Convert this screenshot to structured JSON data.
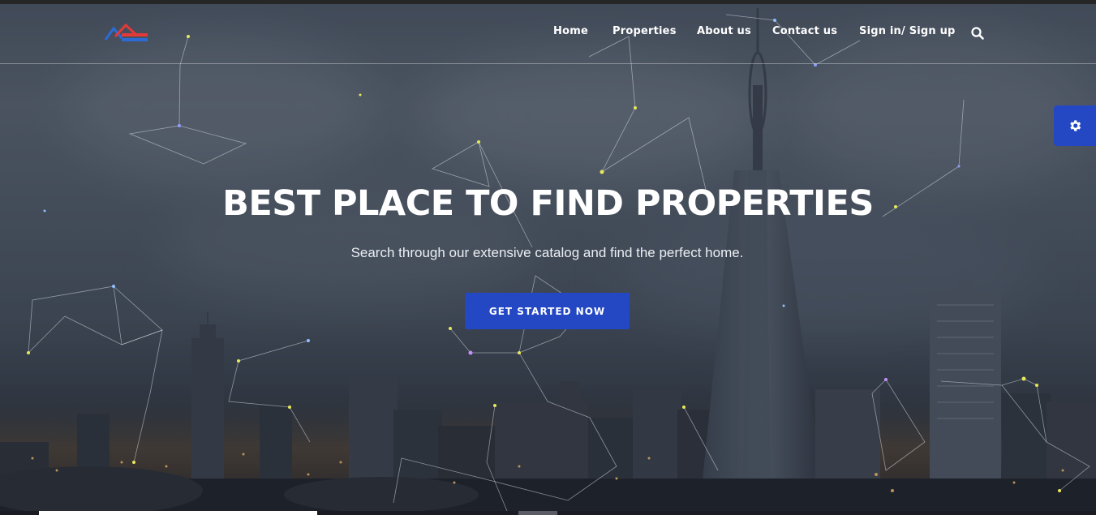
{
  "nav": {
    "items": [
      {
        "label": "Home"
      },
      {
        "label": "Properties"
      },
      {
        "label": "About us"
      },
      {
        "label": "Contact us"
      },
      {
        "label": "Sign in/ Sign up"
      }
    ],
    "search_icon": "search-icon",
    "logo_icon": "house-logo-icon"
  },
  "hero": {
    "title": "BEST PLACE TO FIND PROPERTIES",
    "subtitle": "Search through our extensive catalog and find the perfect home.",
    "cta_label": "GET STARTED NOW"
  },
  "settings": {
    "icon": "gear-icon"
  },
  "colors": {
    "accent": "#2448c4",
    "text": "#ffffff",
    "logo_red": "#e23a3a",
    "logo_blue": "#2c6bd6"
  }
}
